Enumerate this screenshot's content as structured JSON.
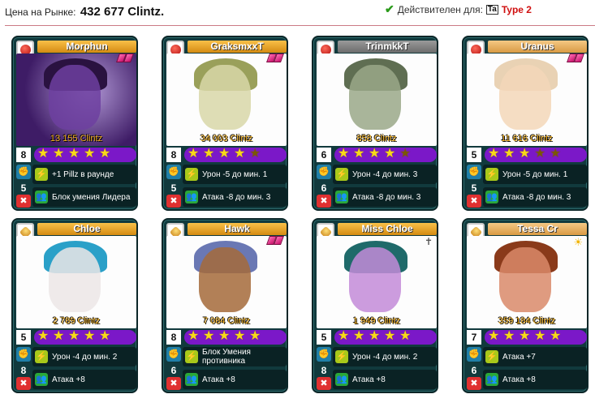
{
  "header": {
    "price_label": "Цена на Рынке:",
    "price_value": "432 677 Clintz.",
    "valid_label": "Действителен для:",
    "type_icon_text": "Ta",
    "type_value": "Type 2"
  },
  "cards": [
    {
      "name": "Morphun",
      "price": "13 155 Clintz",
      "power": "8",
      "damage": "5",
      "stars": 5,
      "ability": "+1 Pillz в раунде",
      "bonus": "Блок умения Лидера",
      "clan_color": "#c81414",
      "plate": "gold",
      "badge": "pink",
      "portrait": "purple"
    },
    {
      "name": "GraksmxxT",
      "price": "34 003 Clintz",
      "power": "8",
      "damage": "5",
      "stars": 4,
      "ability": "Урон -5 до мин. 1",
      "bonus": "Атака -8 до мин. 3",
      "clan_color": "#c81414",
      "plate": "gold",
      "badge": "pink",
      "portrait": "white"
    },
    {
      "name": "TrinmkkT",
      "price": "858 Clintz",
      "power": "6",
      "damage": "6",
      "stars": 4,
      "ability": "Урон -4 до мин. 3",
      "bonus": "Атака -8 до мин. 3",
      "clan_color": "#c81414",
      "plate": "gray",
      "badge": "none",
      "portrait": "white"
    },
    {
      "name": "Uranus",
      "price": "11 616 Clintz",
      "power": "5",
      "damage": "5",
      "stars": 3,
      "ability": "Урон -5 до мин. 1",
      "bonus": "Атака -8 до мин. 3",
      "clan_color": "#c81414",
      "plate": "tan",
      "badge": "pink",
      "portrait": "white"
    },
    {
      "name": "Chloe",
      "price": "2 789 Clintz",
      "power": "5",
      "damage": "8",
      "stars": 5,
      "ability": "Урон -4 до мин. 2",
      "bonus": "Атака +8",
      "clan_color": "#d68a14",
      "plate": "gold",
      "badge": "none",
      "portrait": "white"
    },
    {
      "name": "Hawk",
      "price": "7 084 Clintz",
      "power": "8",
      "damage": "6",
      "stars": 5,
      "ability": "Блок Умения противника",
      "bonus": "Атака +8",
      "clan_color": "#d68a14",
      "plate": "gold",
      "badge": "pink",
      "portrait": "white"
    },
    {
      "name": "Miss Chloe",
      "price": "1 949 Clintz",
      "power": "5",
      "damage": "8",
      "stars": 5,
      "ability": "Урон -4 до мин. 2",
      "bonus": "Атака +8",
      "clan_color": "#d68a14",
      "plate": "gold",
      "badge": "star",
      "portrait": "white"
    },
    {
      "name": "Tessa Cr",
      "price": "359 184 Clintz",
      "power": "7",
      "damage": "6",
      "stars": 5,
      "ability": "Атака +7",
      "bonus": "Атака +8",
      "clan_color": "#d68a14",
      "plate": "tan",
      "badge": "sun",
      "portrait": "white"
    }
  ]
}
